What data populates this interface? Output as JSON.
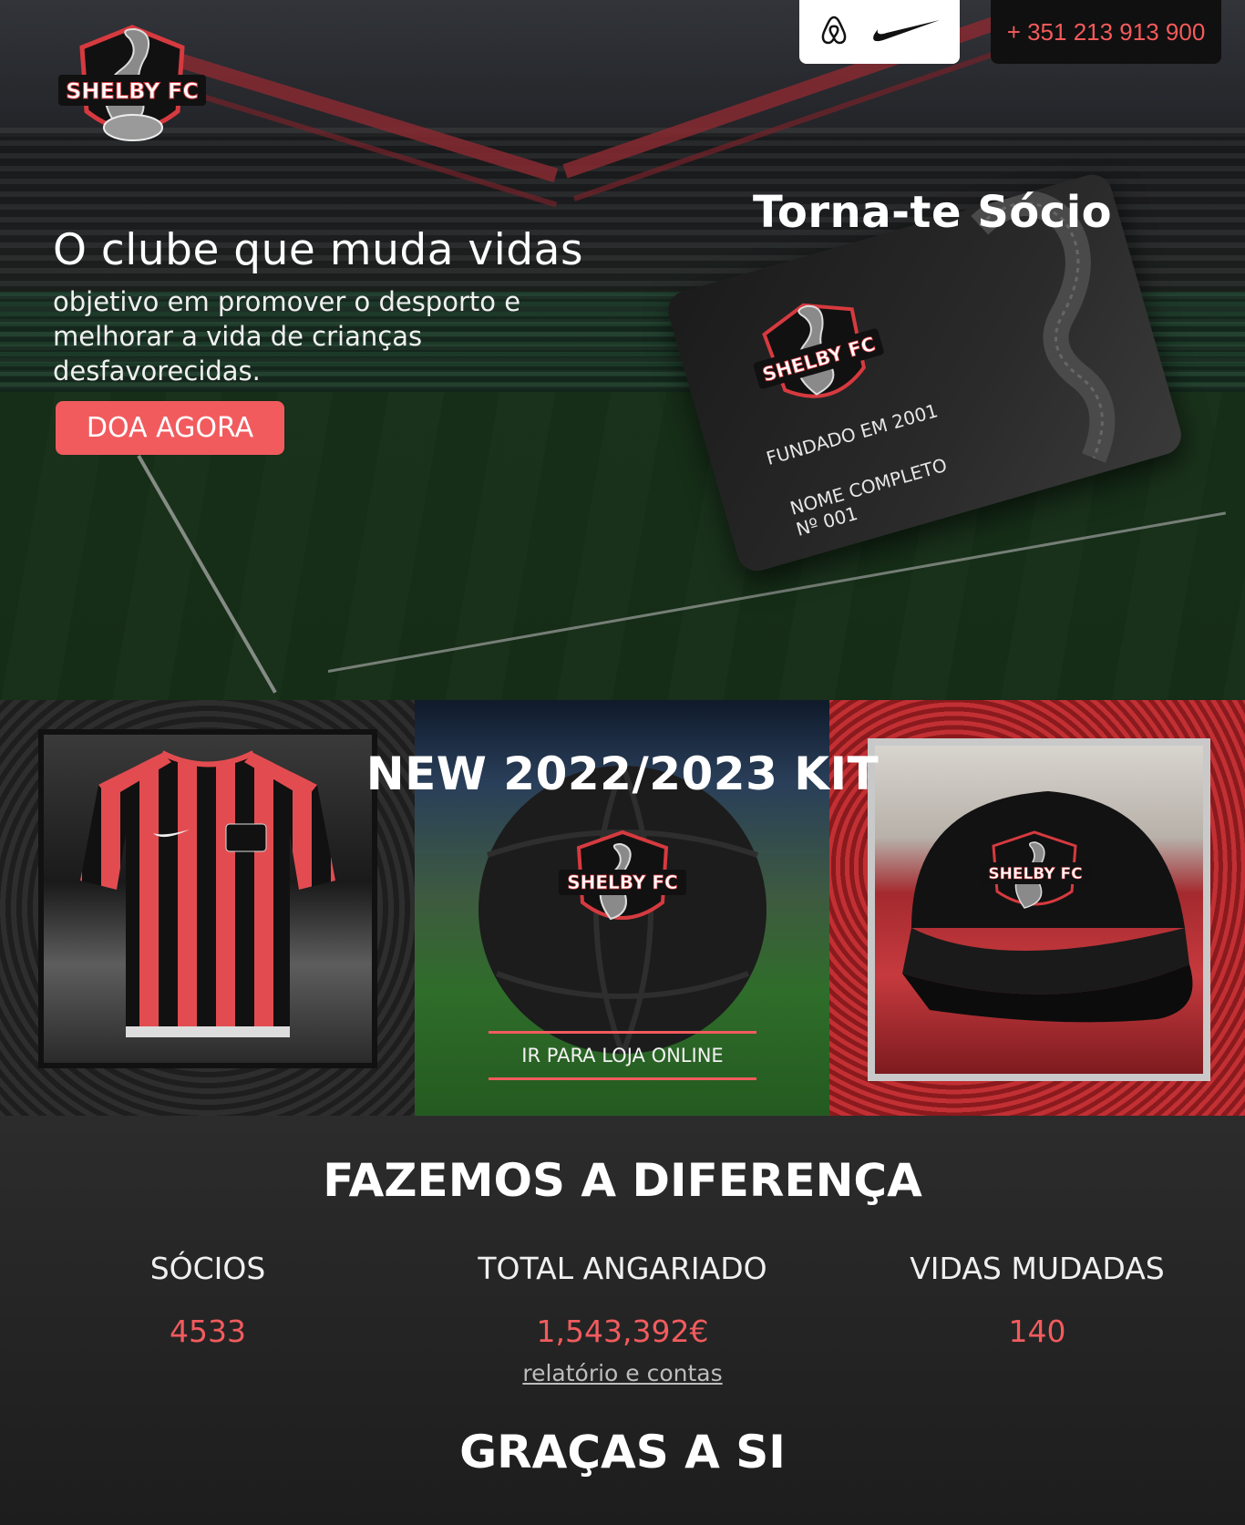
{
  "header": {
    "logo_text": "SHELBY FC",
    "phone": "+ 351 213 913 900",
    "sponsors": [
      "airbnb-icon",
      "nike-icon"
    ]
  },
  "hero": {
    "title": "O clube que muda vidas",
    "subtitle": "objetivo em promover o desporto e melhorar a vida de crianças desfavorecidas.",
    "donate_label": "DOA AGORA"
  },
  "membership": {
    "title": "Torna-te Sócio",
    "card_logo": "SHELBY FC",
    "founded": "FUNDADO EM 2001",
    "name_line": "NOME COMPLETO",
    "number_line": "Nº 001"
  },
  "kit": {
    "title": "NEW 2022/2023 KIT",
    "shop_label": "IR PARA LOJA ONLINE",
    "ball_logo": "SHELBY FC",
    "cap_logo": "SHELBY FC"
  },
  "impact": {
    "title": "FAZEMOS A DIFERENÇA",
    "stats": [
      {
        "label": "SÓCIOS",
        "value": "4533"
      },
      {
        "label": "TOTAL ANGARIADO",
        "value": "1,543,392€"
      },
      {
        "label": "VIDAS MUDADAS",
        "value": "140"
      }
    ],
    "report_link": "relatório e contas",
    "thanks": "GRAÇAS A SI"
  },
  "colors": {
    "accent": "#f25b5e",
    "dark": "#101010"
  }
}
